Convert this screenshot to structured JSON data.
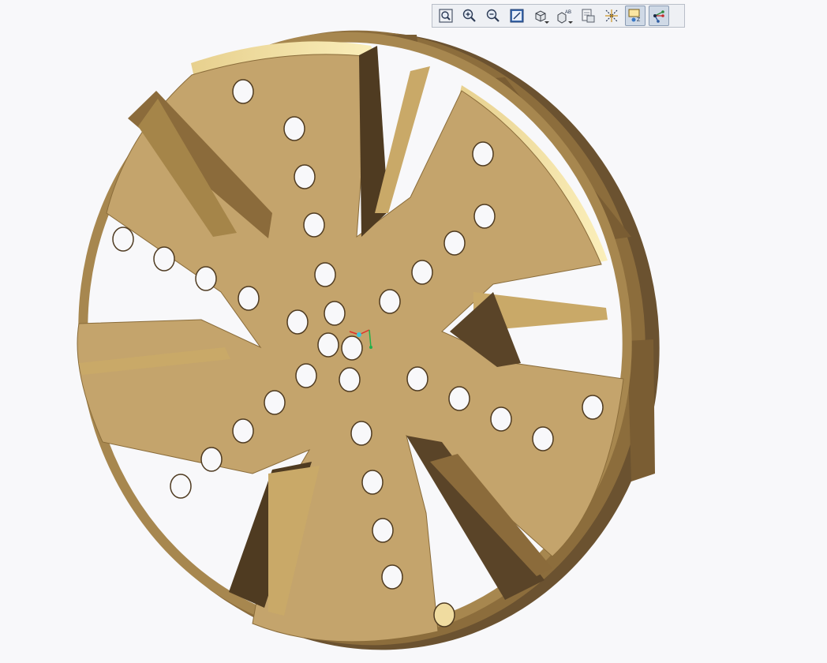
{
  "app": {
    "background_color": "#f8f8fa",
    "model_color": "#c4a46c",
    "model_shadow_color": "#5a4428",
    "model_highlight_color": "#f3e3a4"
  },
  "toolbar": {
    "buttons": [
      {
        "name": "refit-button",
        "icon": "refit-zoom-icon",
        "active": false
      },
      {
        "name": "zoom-in-button",
        "icon": "zoom-in-icon",
        "active": false
      },
      {
        "name": "zoom-out-button",
        "icon": "zoom-out-icon",
        "active": false
      },
      {
        "name": "repaint-button",
        "icon": "repaint-icon",
        "active": false
      },
      {
        "name": "display-style-button",
        "icon": "shaded-cube-icon",
        "active": false,
        "dropdown": true
      },
      {
        "name": "saved-views-button",
        "icon": "saved-views-icon",
        "active": false,
        "dropdown": true
      },
      {
        "name": "view-manager-button",
        "icon": "view-manager-icon",
        "active": false
      },
      {
        "name": "datum-display-button",
        "icon": "datum-planes-icon",
        "active": false
      },
      {
        "name": "spin-center-button",
        "icon": "spin-center-icon",
        "active": true
      },
      {
        "name": "csys-display-button",
        "icon": "coordinate-system-icon",
        "active": true
      }
    ],
    "labels": {
      "saved_views_glyph": "AB"
    }
  }
}
